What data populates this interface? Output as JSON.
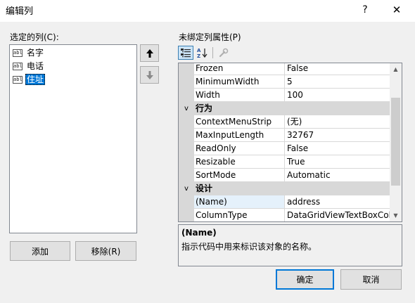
{
  "window": {
    "title": "编辑列",
    "help": "?",
    "close": "✕"
  },
  "left": {
    "label": "选定的列(C):",
    "columns": [
      {
        "label": "名字",
        "icon": "textbox-column-icon",
        "icon_text": "abl"
      },
      {
        "label": "电话",
        "icon": "textbox-column-icon",
        "icon_text": "abl"
      },
      {
        "label": "住址",
        "icon": "textbox-column-icon",
        "icon_text": "abl",
        "selected": true
      }
    ],
    "add_label": "添加",
    "remove_label": "移除(R)"
  },
  "right": {
    "label": "未绑定列属性(P)",
    "toolbar": {
      "categorized": "categorized-icon",
      "alphabetical": "alphabetical-sort-icon",
      "property_pages": "property-pages-icon"
    },
    "rows": [
      {
        "type": "prop",
        "name": "Frozen",
        "value": "False"
      },
      {
        "type": "prop",
        "name": "MinimumWidth",
        "value": "5"
      },
      {
        "type": "prop",
        "name": "Width",
        "value": "100"
      },
      {
        "type": "category",
        "name": "行为",
        "toggle": "v"
      },
      {
        "type": "prop",
        "name": "ContextMenuStrip",
        "value": "(无)"
      },
      {
        "type": "prop",
        "name": "MaxInputLength",
        "value": "32767"
      },
      {
        "type": "prop",
        "name": "ReadOnly",
        "value": "False"
      },
      {
        "type": "prop",
        "name": "Resizable",
        "value": "True"
      },
      {
        "type": "prop",
        "name": "SortMode",
        "value": "Automatic"
      },
      {
        "type": "category",
        "name": "设计",
        "toggle": "v"
      },
      {
        "type": "prop",
        "name": "(Name)",
        "value": "address",
        "selected": true
      },
      {
        "type": "prop",
        "name": "ColumnType",
        "value": "DataGridViewTextBoxColumn"
      }
    ],
    "description": {
      "title": "(Name)",
      "text": "指示代码中用来标识该对象的名称。"
    }
  },
  "footer": {
    "ok_label": "确定",
    "cancel_label": "取消"
  },
  "colors": {
    "accent": "#0078d7",
    "category_bg": "#d8d8d8"
  }
}
